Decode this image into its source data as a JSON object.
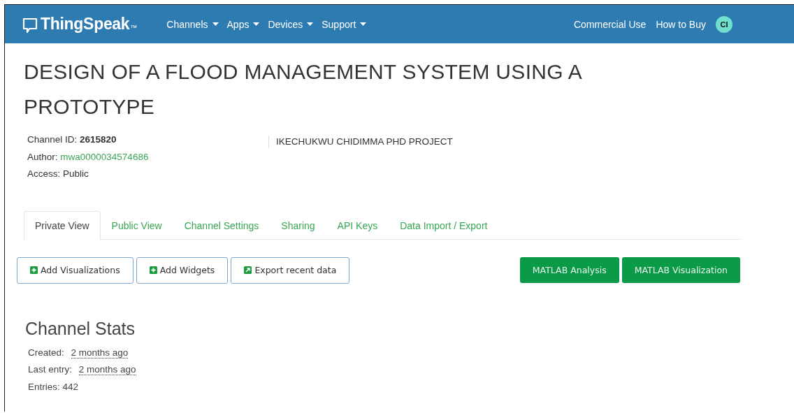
{
  "navbar": {
    "brand": "ThingSpeak",
    "trademark": "™",
    "menus": [
      {
        "label": "Channels",
        "dropdown": true
      },
      {
        "label": "Apps",
        "dropdown": true
      },
      {
        "label": "Devices",
        "dropdown": true
      },
      {
        "label": "Support",
        "dropdown": true
      }
    ],
    "links": [
      "Commercial Use",
      "How to Buy"
    ],
    "avatar": "CI"
  },
  "title": "DESIGN OF A FLOOD MANAGEMENT SYSTEM USING A PROTOTYPE",
  "meta": [
    {
      "label": "Channel ID:",
      "value": "2615820",
      "kind": "bold"
    },
    {
      "label": "Author:",
      "value": "mwa0000034574686",
      "kind": "link"
    },
    {
      "label": "Access:",
      "value": "Public",
      "kind": "plain"
    }
  ],
  "description": "IKECHUKWU CHIDIMMA PHD PROJECT",
  "tabs": [
    {
      "label": "Private View",
      "selected": true
    },
    {
      "label": "Public View",
      "selected": false
    },
    {
      "label": "Channel Settings",
      "selected": false
    },
    {
      "label": "Sharing",
      "selected": false
    },
    {
      "label": "API Keys",
      "selected": false
    },
    {
      "label": "Data Import / Export",
      "selected": false
    }
  ],
  "actions": [
    {
      "label": "Add Visualizations",
      "kind": "plus"
    },
    {
      "label": "Add Widgets",
      "kind": "plus"
    },
    {
      "label": "Export recent data",
      "kind": "export"
    }
  ],
  "matlab_buttons": [
    "MATLAB Analysis",
    "MATLAB Visualization"
  ],
  "stats": {
    "heading": "Channel Stats",
    "rows": [
      {
        "label": "Created:",
        "value": "2 months ago",
        "kind": "time"
      },
      {
        "label": "Last entry:",
        "value": "2 months ago",
        "kind": "time"
      },
      {
        "label": "Entries:",
        "value": "442",
        "kind": "plain"
      }
    ]
  }
}
